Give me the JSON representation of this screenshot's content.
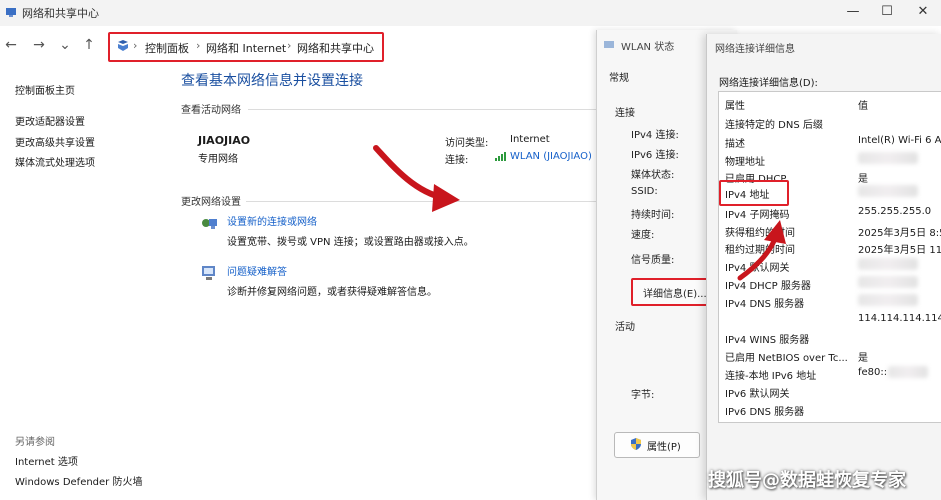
{
  "main": {
    "title": "网络和共享中心",
    "window_controls": {
      "minimize": "—",
      "maximize": "☐",
      "close": "✕"
    },
    "nav": {
      "back": "←",
      "forward": "→",
      "down": "⌄",
      "up": "↑"
    },
    "breadcrumb": [
      "控制面板",
      "网络和 Internet",
      "网络和共享中心"
    ],
    "breadcrumb_sep": "›",
    "sidebar": {
      "items": [
        "控制面板主页",
        "更改适配器设置",
        "更改高级共享设置",
        "媒体流式处理选项"
      ],
      "see_also_heading": "另请参阅",
      "see_also": [
        "Internet 选项",
        "Windows Defender 防火墙"
      ]
    },
    "page_heading": "查看基本网络信息并设置连接",
    "active_networks_heading": "查看活动网络",
    "network": {
      "name": "JIAOJIAO",
      "category": "专用网络",
      "access_type_label": "访问类型:",
      "access_type_value": "Internet",
      "connection_label": "连接:",
      "connection_value": "WLAN (JIAOJIAO)"
    },
    "change_settings_heading": "更改网络设置",
    "actions": [
      {
        "title": "设置新的连接或网络",
        "desc": "设置宽带、拨号或 VPN 连接；或设置路由器或接入点。"
      },
      {
        "title": "问题疑难解答",
        "desc": "诊断并修复网络问题，或者获得疑难解答信息。"
      }
    ]
  },
  "wlan": {
    "title": "WLAN 状态",
    "tab": "常规",
    "section_connection": "连接",
    "fields": [
      "IPv4 连接:",
      "IPv6 连接:",
      "媒体状态:",
      "SSID:",
      "持续时间:",
      "速度:"
    ],
    "signal_label": "信号质量:",
    "details_button": "详细信息(E)...",
    "section_activity": "活动",
    "bytes_label": "字节:",
    "properties_button": "属性(P)"
  },
  "details": {
    "title": "网络连接详细信息",
    "list_label": "网络连接详细信息(D):",
    "col_property": "属性",
    "col_value": "值",
    "rows": [
      {
        "property": "连接特定的 DNS 后缀",
        "value": ""
      },
      {
        "property": "描述",
        "value": "Intel(R) Wi-Fi 6 A"
      },
      {
        "property": "物理地址",
        "value": ""
      },
      {
        "property": "已启用 DHCP",
        "value": "是"
      },
      {
        "property": "IPv4 地址",
        "value": ""
      },
      {
        "property": "IPv4 子网掩码",
        "value": "255.255.255.0"
      },
      {
        "property": "获得租约的时间",
        "value": "2025年3月5日 8:5"
      },
      {
        "property": "租约过期的时间",
        "value": "2025年3月5日 11"
      },
      {
        "property": "IPv4 默认网关",
        "value": ""
      },
      {
        "property": "IPv4 DHCP 服务器",
        "value": ""
      },
      {
        "property": "IPv4 DNS 服务器",
        "value": ""
      },
      {
        "property": "",
        "value": "114.114.114.114"
      },
      {
        "property": "IPv4 WINS 服务器",
        "value": ""
      },
      {
        "property": "已启用 NetBIOS over Tc...",
        "value": "是"
      },
      {
        "property": "连接-本地 IPv6 地址",
        "value": "fe80::"
      },
      {
        "property": "IPv6 默认网关",
        "value": ""
      },
      {
        "property": "IPv6 DNS 服务器",
        "value": ""
      }
    ]
  },
  "watermark": "搜狐号@数据蛙恢复专家",
  "colors": {
    "accent_red": "#e0202a",
    "link_blue": "#1560c9",
    "heading_blue": "#1a4fa0"
  }
}
